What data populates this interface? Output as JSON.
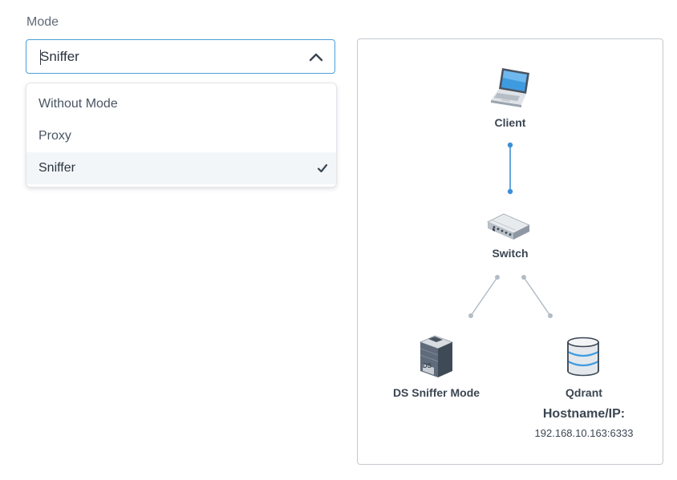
{
  "mode": {
    "label": "Mode",
    "selected_value": "Sniffer",
    "options": [
      {
        "label": "Without Mode",
        "selected": false
      },
      {
        "label": "Proxy",
        "selected": false
      },
      {
        "label": "Sniffer",
        "selected": true
      }
    ]
  },
  "diagram": {
    "nodes": {
      "client": {
        "label": "Client",
        "icon": "laptop-icon"
      },
      "switch": {
        "label": "Switch",
        "icon": "network-switch-icon"
      },
      "sniffer": {
        "label": "DS Sniffer Mode",
        "icon": "server-icon",
        "badge": "DS"
      },
      "qdrant": {
        "label": "Qdrant",
        "icon": "database-icon"
      }
    },
    "host": {
      "label": "Hostname/IP:",
      "value": "192.168.10.163:6333"
    },
    "colors": {
      "active_link": "#3d8fd6",
      "inactive_link": "#b3bcc6"
    }
  }
}
